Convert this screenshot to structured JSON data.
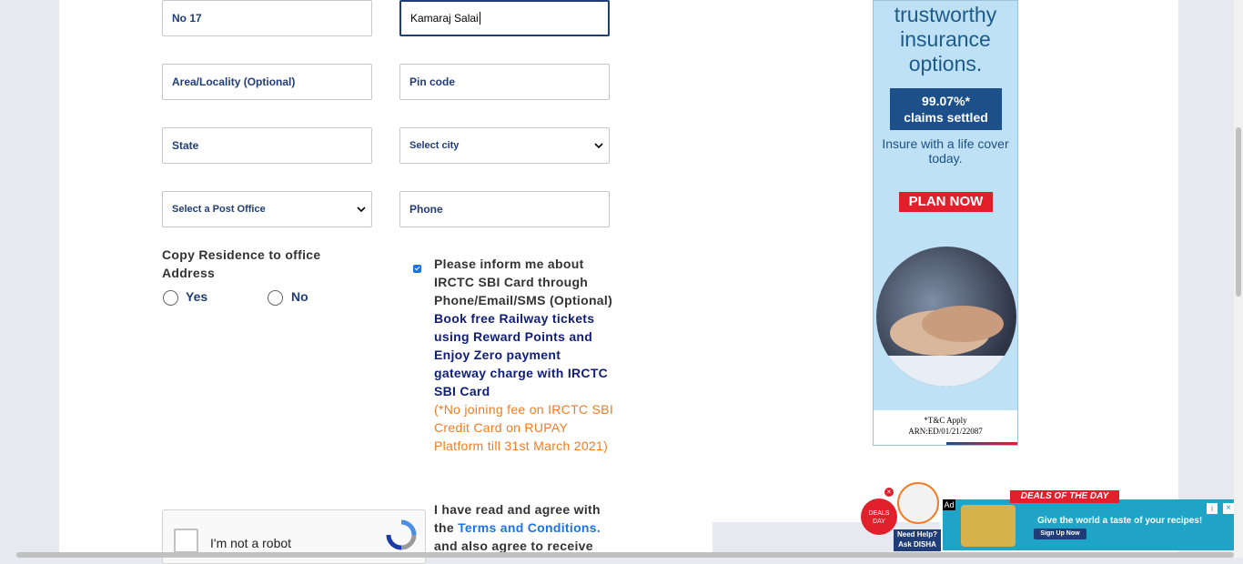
{
  "form": {
    "fields": {
      "house_no": {
        "value": "No 17"
      },
      "street": {
        "value": "Kamaraj Salai"
      },
      "area": {
        "placeholder": "Area/Locality (Optional)"
      },
      "pincode": {
        "placeholder": "Pin code"
      },
      "state": {
        "placeholder": "State"
      },
      "city": {
        "selected": "Select city"
      },
      "post_office": {
        "selected": "Select a Post Office"
      },
      "phone": {
        "placeholder": "Phone"
      }
    },
    "copy_residence": {
      "label": "Copy Residence to office Address",
      "yes": "Yes",
      "no": "No"
    },
    "inform_consent": {
      "checked": true,
      "text_dark": "Please inform me about IRCTC SBI Card through Phone/Email/SMS (Optional)",
      "text_blue": "Book free Railway tickets using Reward Points and Enjoy Zero payment gateway charge with IRCTC SBI Card",
      "text_orange": "(*No joining fee on IRCTC SBI Credit Card on RUPAY Platform till 31st March 2021)"
    },
    "terms": {
      "prefix": "I have read and agree with the",
      "link": "Terms and Conditions.",
      "suffix": "and also agree to receive"
    },
    "captcha": {
      "label": "I'm not a robot"
    }
  },
  "ad_sidebar": {
    "headline": "trustworthy insurance options.",
    "badge_line1": "99.07%*",
    "badge_line2": "claims settled",
    "subtext": "Insure with a life cover today.",
    "cta": "PLAN NOW",
    "footer_line1": "*T&C Apply",
    "footer_line2": "ARN:ED/01/21/22087"
  },
  "bottom_banner": {
    "ad_tag": "Ad",
    "deals": "DEALS OF THE DAY",
    "headline": "Give the world a taste of your recipes!",
    "cta": "Sign Up Now",
    "help_line1": "Need Help?",
    "help_line2": "Ask DISHA"
  }
}
